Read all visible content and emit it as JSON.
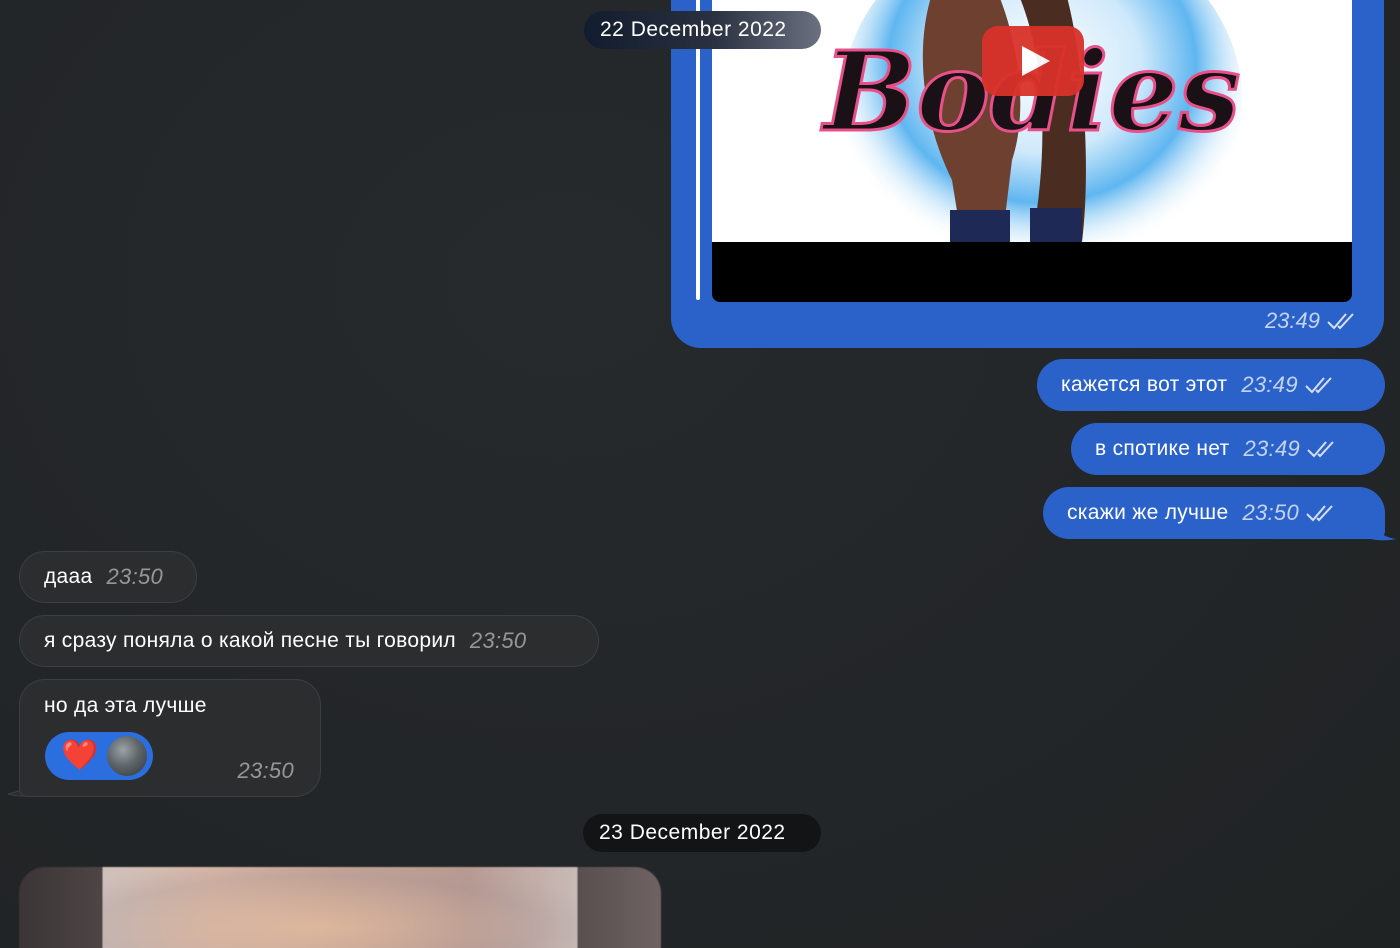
{
  "date_separators": [
    "22 December 2022",
    "23 December 2022"
  ],
  "messages": {
    "media": {
      "time": "23:49",
      "status": "read",
      "thumbnail_text": "Bodies"
    },
    "out": [
      {
        "text": "кажется вот этот",
        "time": "23:49",
        "status": "read"
      },
      {
        "text": "в спотике нет",
        "time": "23:49",
        "status": "read"
      },
      {
        "text": "скажи же лучше",
        "time": "23:50",
        "status": "read"
      }
    ],
    "in": [
      {
        "text": "дааа",
        "time": "23:50"
      },
      {
        "text": "я сразу поняла о какой песне ты говорил",
        "time": "23:50"
      },
      {
        "text": "но да эта лучше",
        "time": "23:50",
        "reaction": "❤️"
      }
    ]
  },
  "colors": {
    "outgoing_bubble": "#2a62c9",
    "incoming_bubble": "#2b2d2f",
    "background": "#232628",
    "reaction": "#2a6ee0"
  },
  "icons": [
    "play-icon",
    "double-check-icon",
    "heart-icon",
    "avatar"
  ]
}
